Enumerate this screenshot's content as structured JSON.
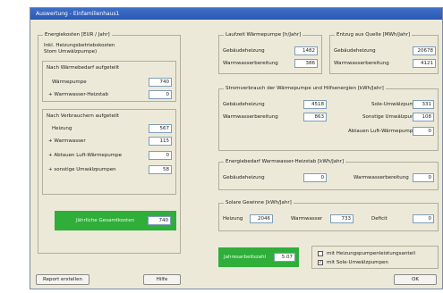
{
  "window": {
    "title": "Auswertung - Einfamilienhaus1"
  },
  "energy": {
    "title": "Energiekosten [EUR / Jahr]",
    "subtitle_1": "Inkl. Heizungsbetriebskosten",
    "subtitle_2": "Stom Umwälzpumpe)",
    "by_demand": {
      "title": "Nach Wärmebedarf aufgeteilt",
      "rows": [
        {
          "label": "Wärmepumpe",
          "value": "740"
        },
        {
          "label": "+ Warmwasser-Heizstab",
          "value": "0"
        }
      ]
    },
    "by_consumer": {
      "title": "Nach Verbrauchern aufgeteilt",
      "rows": [
        {
          "label": "Heizung",
          "value": "567"
        },
        {
          "label": "+ Warmwasser",
          "value": "115"
        },
        {
          "label": "+ Abtauen Luft-Wärmepumpe",
          "value": "0"
        },
        {
          "label": "+ sonstige Umwälzpumpen",
          "value": "58"
        }
      ]
    },
    "total": {
      "label": "Jährliche Gesamtkosten",
      "value": "740"
    }
  },
  "demand": {
    "title": "Laufzeit Wärmepumpe [h/Jahr]",
    "rows": [
      {
        "label": "Gebäudeheizung",
        "value": "1482"
      },
      {
        "label": "Warmwasserbereitung",
        "value": "386"
      }
    ]
  },
  "yield": {
    "title": "Entzug aus Quelle [MWh/Jahr]",
    "rows": [
      {
        "label": "Gebäudeheizung",
        "value": "20678"
      },
      {
        "label": "Warmwasserbereitung",
        "value": "4121"
      }
    ]
  },
  "consumption": {
    "title": "Stromverbrauch der Wärmepumpe und Hilfsenergien [kWh/Jahr]",
    "left": [
      {
        "label": "Gebäudeheizung",
        "value": "4518"
      },
      {
        "label": "Warmwasserbereitung",
        "value": "863"
      }
    ],
    "right": [
      {
        "label": "Sole-Umwälzpumpen",
        "value": "331"
      },
      {
        "label": "Sonstige Umwälzpumpen",
        "value": "108"
      },
      {
        "label": "Abtauen Luft-Wärmepumpe",
        "value": "0"
      }
    ]
  },
  "electric": {
    "title": "Energiebedarf Warmwasser-Heizstab [kWh/Jahr]",
    "left": {
      "label": "Gebäudeheizung",
      "value": "0"
    },
    "right": {
      "label": "Warmwasserbereitung",
      "value": "0"
    }
  },
  "solar": {
    "title": "Solare Gewinne [kWh/Jahr]",
    "items": [
      {
        "label": "Heizung",
        "value": "2046"
      },
      {
        "label": "Warmwasser",
        "value": "733"
      },
      {
        "label": "Deficit",
        "value": "0"
      }
    ]
  },
  "annual_factor": {
    "label": "Jahresarbeitszahl",
    "value": "5.07"
  },
  "options": [
    {
      "label": "mit Heizungspumpenleistungsanteil",
      "checked": false
    },
    {
      "label": "mit Sole-Umwälzpumpen",
      "checked": true
    }
  ],
  "buttons": {
    "report": "Report erstellen",
    "help": "Hilfe",
    "ok": "OK"
  }
}
